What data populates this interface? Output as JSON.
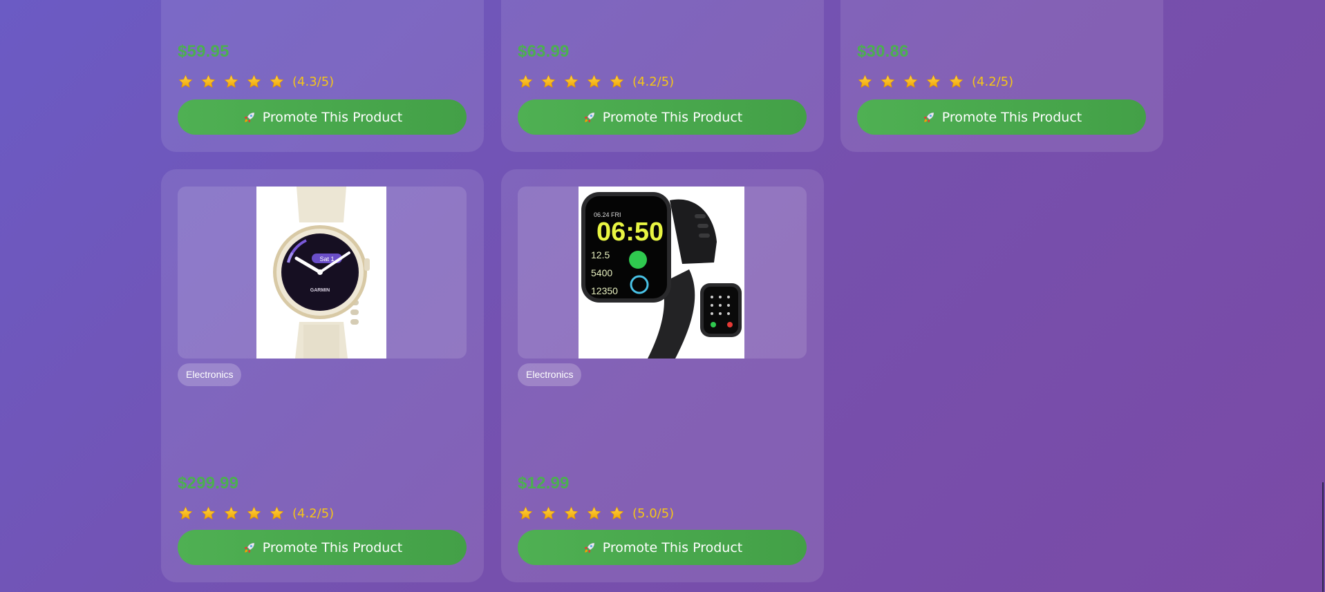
{
  "colors": {
    "price": "#4caf50",
    "star": "#f5b301",
    "rating_text": "#f5c518",
    "button": "#4caf50"
  },
  "star_icon": "star-icon",
  "button_icon": "rocket-icon",
  "products": [
    {
      "price": "$59.95",
      "rating": 4.3,
      "rating_text": "(4.3/5)",
      "button_label": "Promote This Product"
    },
    {
      "price": "$63.99",
      "rating": 4.2,
      "rating_text": "(4.2/5)",
      "button_label": "Promote This Product"
    },
    {
      "price": "$30.86",
      "rating": 4.2,
      "rating_text": "(4.2/5)",
      "button_label": "Promote This Product"
    },
    {
      "category": "Electronics",
      "image": "garmin-smartwatch-image",
      "price": "$299.99",
      "rating": 4.2,
      "rating_text": "(4.2/5)",
      "button_label": "Promote This Product",
      "watch_brand": "GARMIN",
      "watch_date": "Sat 1"
    },
    {
      "category": "Electronics",
      "image": "black-smartwatch-image",
      "price": "$12.99",
      "rating": 5.0,
      "rating_text": "(5.0/5)",
      "button_label": "Promote This Product",
      "watch_time": "06:50",
      "watch_date": "06.24 FRI",
      "watch_km": "12.5",
      "watch_kcal": "5400",
      "watch_steps": "12350"
    }
  ]
}
